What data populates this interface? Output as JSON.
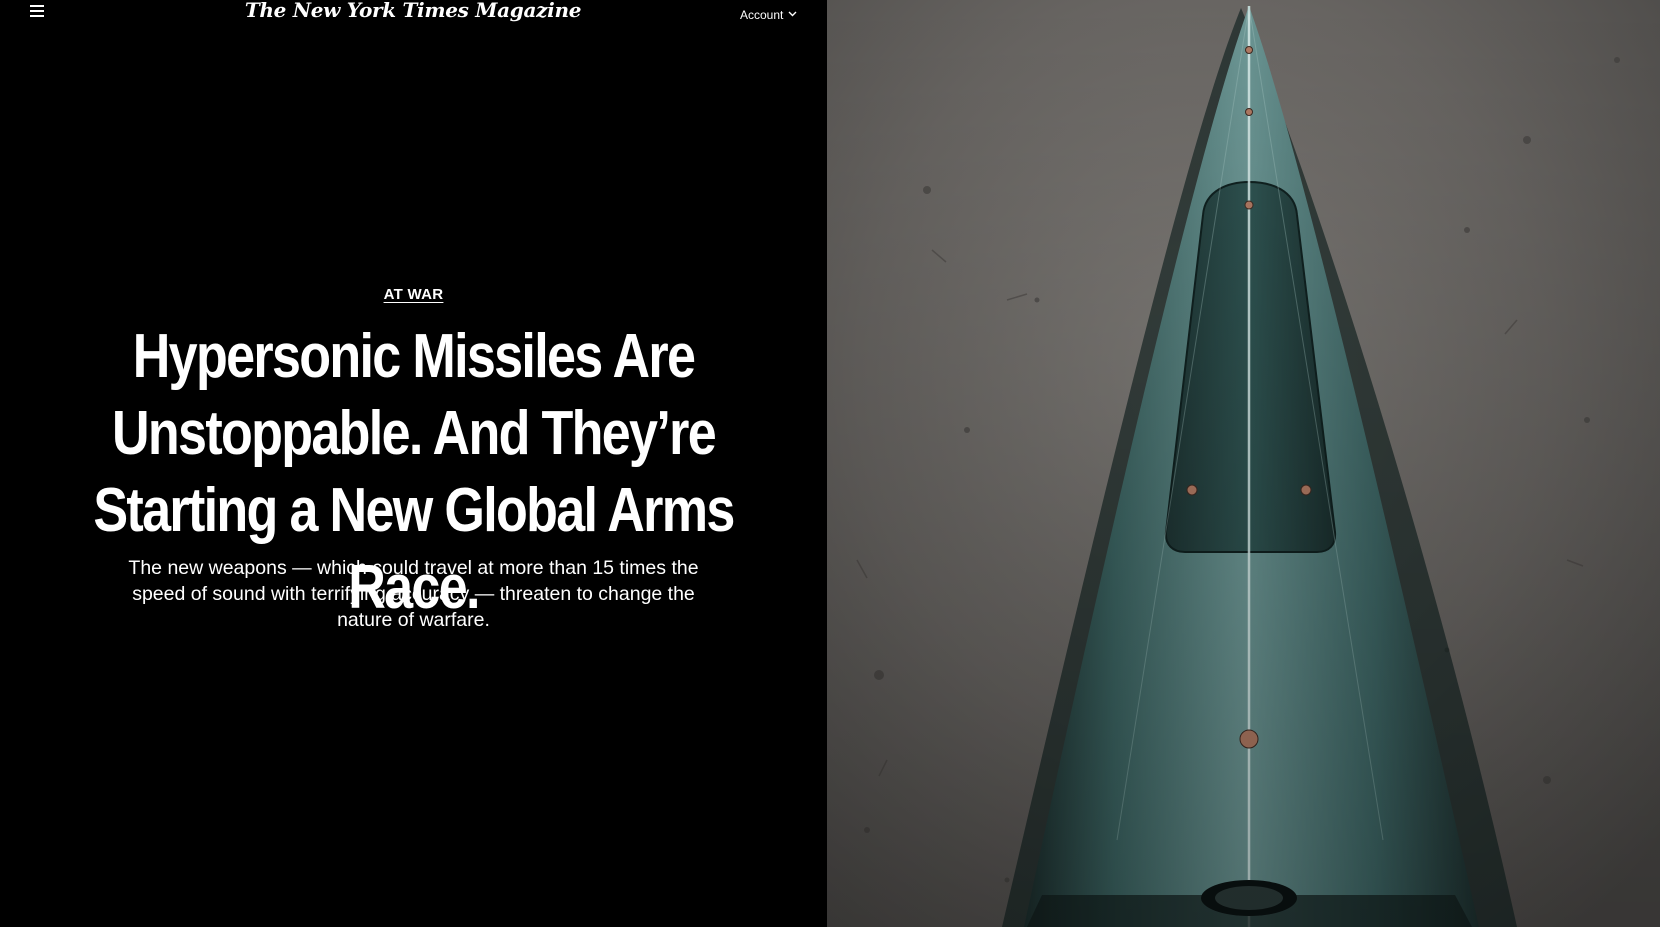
{
  "header": {
    "menu_icon": "hamburger-menu-icon",
    "masthead": "The New York Times Magazine",
    "account_label": "Account",
    "account_icon": "chevron-down-icon"
  },
  "article": {
    "kicker": "AT WAR",
    "headline": "Hypersonic Missiles Are Unstoppable. And They’re Starting a New Global Arms Race.",
    "dek": "The new weapons — which could travel at more than 15 times the speed of sound with terrifying accuracy — threaten to change the nature of warfare."
  },
  "colors": {
    "background": "#000000",
    "text": "#ffffff",
    "concrete": "#6b6865",
    "missile_teal": "#4f7a78"
  }
}
